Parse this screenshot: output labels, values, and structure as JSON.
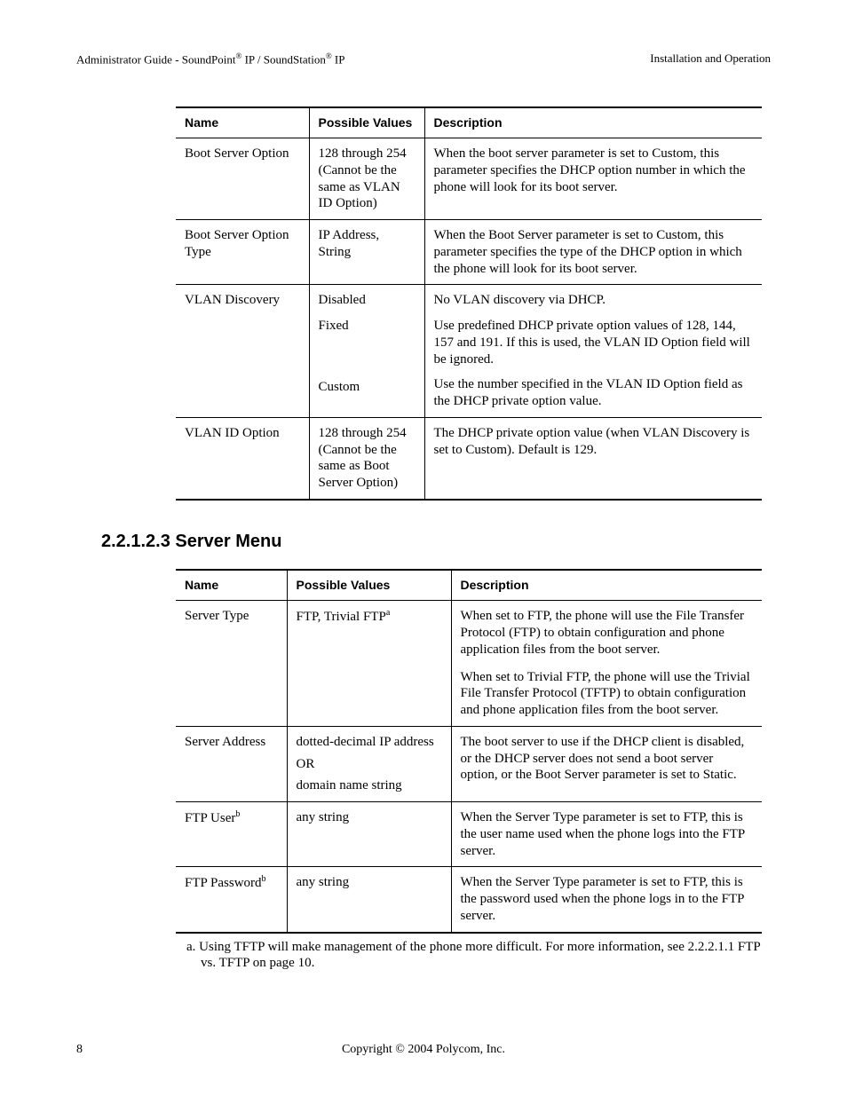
{
  "header": {
    "left_pre": "Administrator Guide - SoundPoint",
    "left_mid": " IP / SoundStation",
    "left_post": " IP",
    "right": "Installation and Operation"
  },
  "table1": {
    "head": {
      "c1": "Name",
      "c2": "Possible Values",
      "c3": "Description"
    },
    "rows": [
      {
        "name": "Boot Server Option",
        "val": "128 through 254 (Cannot be the same as VLAN ID Option)",
        "desc": "When the boot server parameter is set to Custom, this parameter specifies the DHCP option number in which the phone will look for its boot server."
      },
      {
        "name": "Boot Server Option Type",
        "val": "IP Address, String",
        "desc": "When the Boot Server parameter is set to Custom, this parameter specifies the type of the DHCP option in which the phone will look for its boot server."
      },
      {
        "name": "VLAN Discovery",
        "val1": "Disabled",
        "desc1": "No VLAN discovery via DHCP.",
        "val2": "Fixed",
        "desc2": "Use predefined DHCP private option values of 128, 144, 157 and 191.  If this is used, the VLAN ID Option field will be ignored.",
        "val3": "Custom",
        "desc3": "Use the number specified in the VLAN ID Option field as the DHCP private option value."
      },
      {
        "name": "VLAN ID Option",
        "val": "128 through 254 (Cannot be the same as Boot Server Option)",
        "desc": "The DHCP private option value (when VLAN Discovery is set to Custom).  Default is 129."
      }
    ]
  },
  "section_title": "2.2.1.2.3  Server Menu",
  "table2": {
    "head": {
      "c1": "Name",
      "c2": "Possible Values",
      "c3": "Description"
    },
    "rows": [
      {
        "name": "Server Type",
        "val": "FTP, Trivial FTP",
        "val_note": "a",
        "desc1": "When set to FTP, the phone will use the File Transfer Protocol (FTP) to obtain configuration and phone application files from the boot server.",
        "desc2": "When set to Trivial FTP, the phone will use the Trivial File Transfer Protocol (TFTP) to obtain configuration and phone application files from the boot server."
      },
      {
        "name": "Server Address",
        "val_line1": "dotted-decimal IP address",
        "val_line2": "OR",
        "val_line3": "domain name string",
        "desc": "The boot server to use if the DHCP client is disabled, or the DHCP server does not send a boot server option, or the Boot Server parameter is set to Static."
      },
      {
        "name": "FTP User",
        "name_note": "b",
        "val": "any string",
        "desc": "When the Server Type parameter is set to FTP, this is the user name used when the phone logs into the FTP server."
      },
      {
        "name": "FTP Password",
        "name_note": "b",
        "val": "any string",
        "desc": "When the Server Type parameter is set to FTP, this is the password used when the phone logs in to the FTP server."
      }
    ]
  },
  "footnotes": {
    "a": "a.  Using TFTP will make management of the phone more difficult.  For more information, see 2.2.2.1.1 FTP vs. TFTP on page 10."
  },
  "footer": {
    "page": "8",
    "copyright": "Copyright © 2004 Polycom, Inc."
  }
}
